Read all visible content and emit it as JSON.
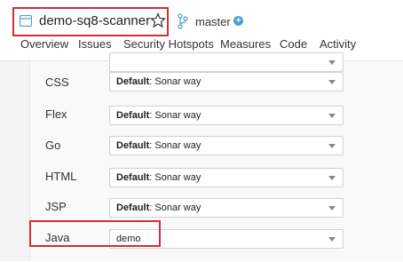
{
  "header": {
    "project_name": "demo-sq8-scanner",
    "branch": "master",
    "branch_add": "+"
  },
  "tabs": [
    {
      "label": "Overview"
    },
    {
      "label": "Issues"
    },
    {
      "label": "Security Hotspots"
    },
    {
      "label": "Measures"
    },
    {
      "label": "Code"
    },
    {
      "label": "Activity"
    }
  ],
  "profiles": [
    {
      "language": "",
      "prefix": "",
      "value": ""
    },
    {
      "language": "CSS",
      "prefix": "Default",
      "value": ": Sonar way"
    },
    {
      "language": "Flex",
      "prefix": "Default",
      "value": ": Sonar way"
    },
    {
      "language": "Go",
      "prefix": "Default",
      "value": ": Sonar way"
    },
    {
      "language": "HTML",
      "prefix": "Default",
      "value": ": Sonar way"
    },
    {
      "language": "JSP",
      "prefix": "Default",
      "value": ": Sonar way"
    },
    {
      "language": "Java",
      "prefix": "",
      "value": "demo"
    }
  ]
}
